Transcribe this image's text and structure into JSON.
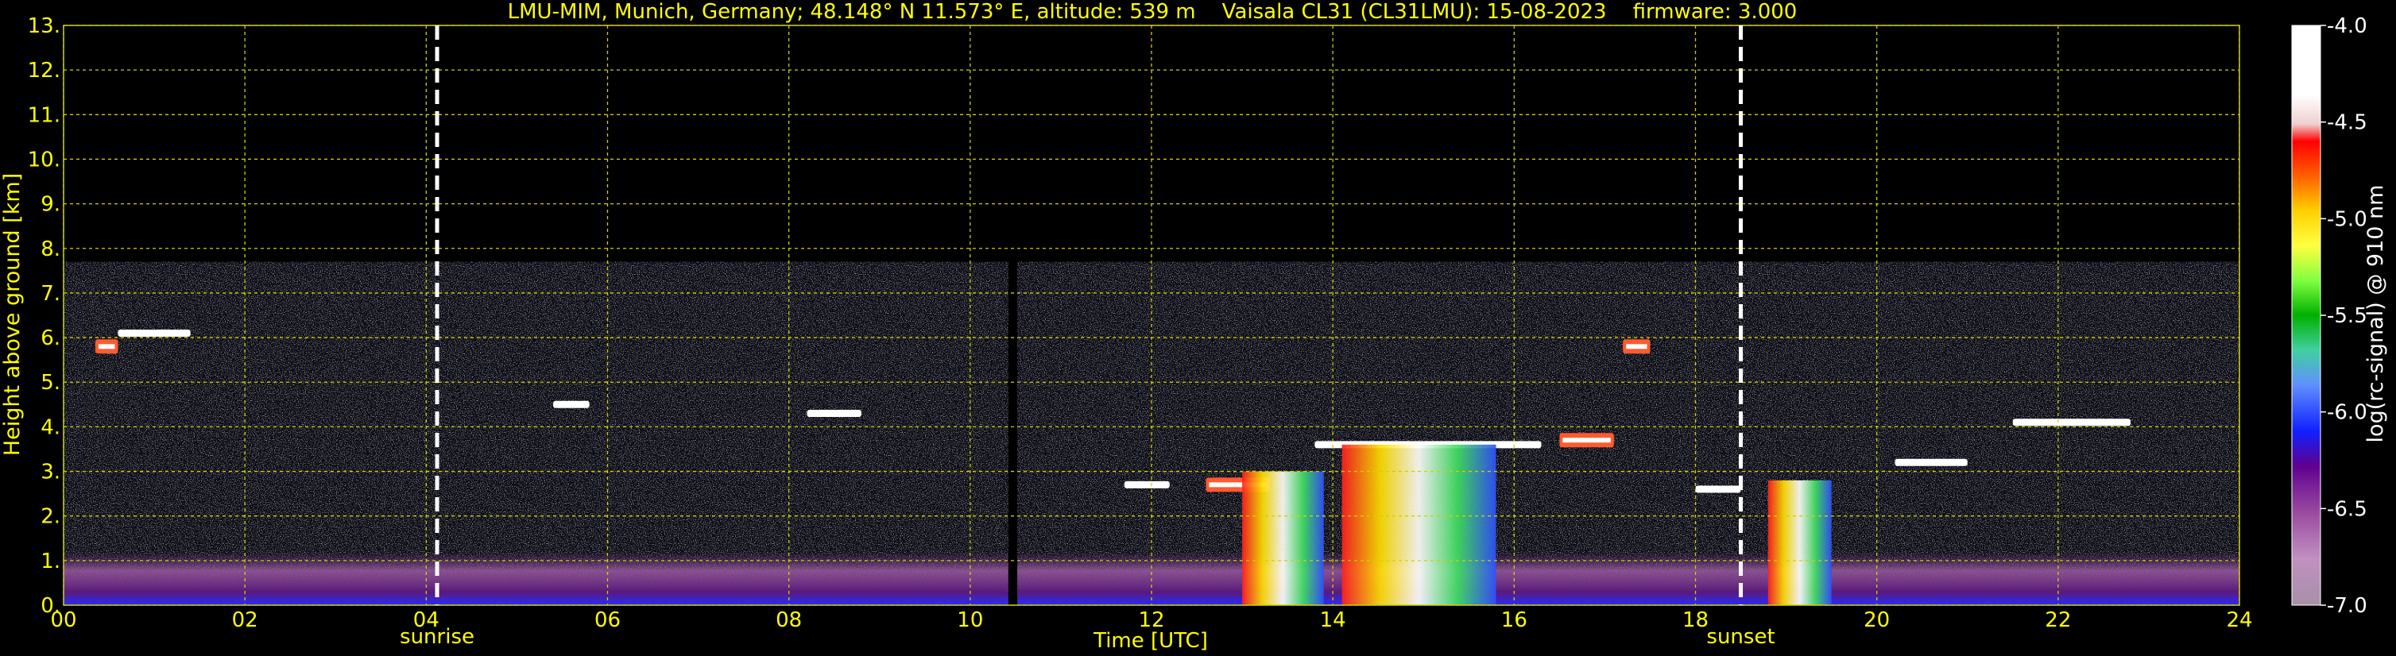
{
  "chart_data": {
    "type": "heatmap",
    "title": "LMU-MIM, Munich, Germany; 48.148° N 11.573° E, altitude: 539 m    Vaisala CL31 (CL31LMU): 15-08-2023    firmware: 3.000",
    "xlabel": "Time [UTC]",
    "ylabel": "Height above ground [km]",
    "colorbar_label": "log(rc-signal) @ 910 nm",
    "xlim": [
      0,
      24
    ],
    "ylim": [
      0,
      13
    ],
    "x_ticks": [
      "00",
      "02",
      "04",
      "06",
      "08",
      "10",
      "12",
      "14",
      "16",
      "18",
      "20",
      "22",
      "24"
    ],
    "y_ticks": [
      "0.",
      "1.",
      "2.",
      "3.",
      "4.",
      "5.",
      "6.",
      "7.",
      "8.",
      "9.",
      "10.",
      "11.",
      "12.",
      "13."
    ],
    "colorbar_ticks": [
      "-4.0",
      "-4.5",
      "-5.0",
      "-5.5",
      "-6.0",
      "-6.5",
      "-7.0"
    ],
    "colorbar_range": [
      -7.0,
      -4.0
    ],
    "grid": true,
    "data_top_km": 7.7,
    "data_gap_hours": [
      10.42,
      10.52
    ],
    "markers": [
      {
        "label": "sunrise",
        "x": 4.12
      },
      {
        "label": "sunset",
        "x": 18.5
      }
    ],
    "features": [
      {
        "kind": "cloud",
        "x": [
          0.6,
          1.4
        ],
        "y": 6.1,
        "value": -4.2
      },
      {
        "kind": "cloud",
        "x": [
          0.35,
          0.6
        ],
        "y": 5.8,
        "value": -4.5
      },
      {
        "kind": "cloud",
        "x": [
          5.4,
          5.8
        ],
        "y": 4.5,
        "value": -4.2
      },
      {
        "kind": "cloud",
        "x": [
          8.2,
          8.8
        ],
        "y": 4.3,
        "value": -4.2
      },
      {
        "kind": "cloud",
        "x": [
          11.7,
          12.2
        ],
        "y": 2.7,
        "value": -4.3
      },
      {
        "kind": "cloud",
        "x": [
          12.6,
          13.3
        ],
        "y": 2.7,
        "value": -4.5
      },
      {
        "kind": "cloud",
        "x": [
          13.8,
          16.3
        ],
        "y": 3.6,
        "value": -4.3
      },
      {
        "kind": "cloud",
        "x": [
          16.5,
          17.1
        ],
        "y": 3.7,
        "value": -4.6
      },
      {
        "kind": "cloud",
        "x": [
          17.2,
          17.5
        ],
        "y": 5.8,
        "value": -4.6
      },
      {
        "kind": "cloud",
        "x": [
          18.0,
          18.5
        ],
        "y": 2.6,
        "value": -4.3
      },
      {
        "kind": "cloud",
        "x": [
          20.2,
          21.0
        ],
        "y": 3.2,
        "value": -4.2
      },
      {
        "kind": "cloud",
        "x": [
          21.5,
          22.8
        ],
        "y": 4.1,
        "value": -4.2
      },
      {
        "kind": "precipitation",
        "x": [
          13.0,
          13.9
        ],
        "y": [
          0,
          3.0
        ],
        "value": -4.8
      },
      {
        "kind": "precipitation",
        "x": [
          14.1,
          15.8
        ],
        "y": [
          0,
          3.6
        ],
        "value": -4.4
      },
      {
        "kind": "precipitation",
        "x": [
          18.8,
          19.5
        ],
        "y": [
          0,
          2.8
        ],
        "value": -4.6
      }
    ]
  }
}
